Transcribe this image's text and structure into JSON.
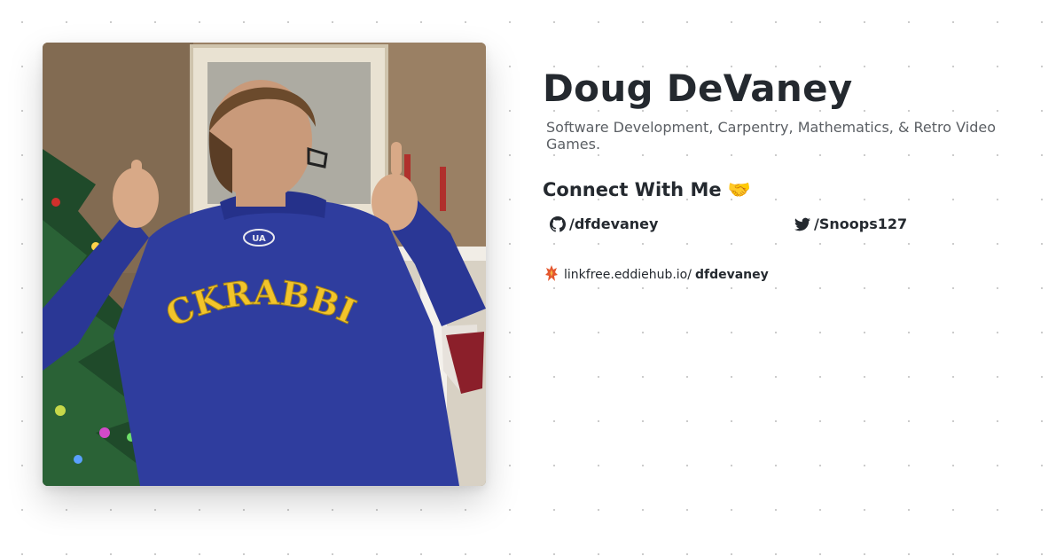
{
  "profile": {
    "name": "Doug DeVaney",
    "bio": "Software Development, Carpentry, Mathematics, & Retro Video Games."
  },
  "connect": {
    "heading": "Connect With Me",
    "emoji": "🤝"
  },
  "socials": [
    {
      "icon": "github-icon",
      "label": "/dfdevaney"
    },
    {
      "icon": "twitter-icon",
      "label": "/Snoops127"
    }
  ],
  "linkfree": {
    "icon": "linkfree-logo-icon",
    "prefix": "linkfree.eddiehub.io/",
    "username": "dfdevaney"
  },
  "photo": {
    "jacket_text": "JACKRABBITS",
    "jacket_color": "#2f3d9e",
    "lettering_color": "#f2c42b"
  }
}
